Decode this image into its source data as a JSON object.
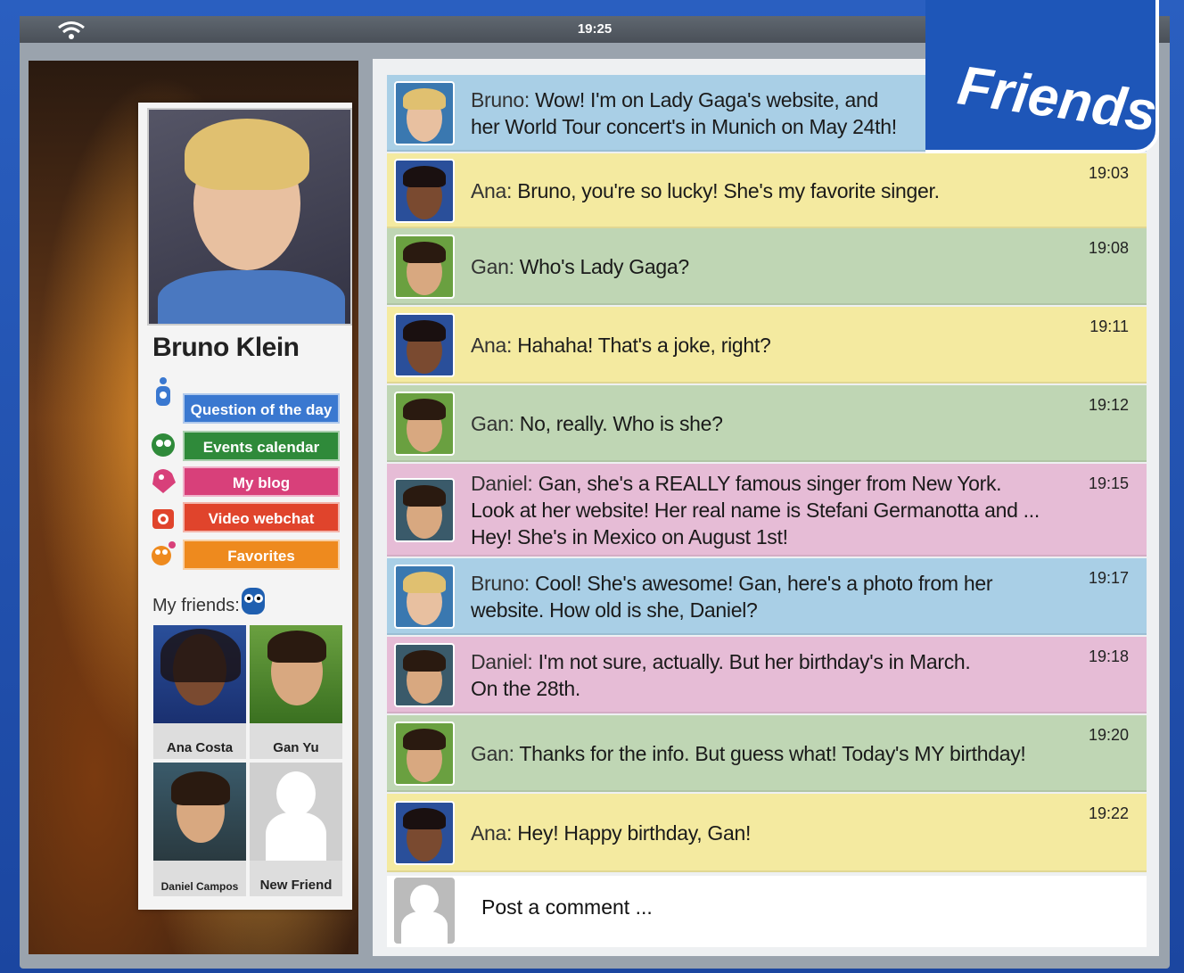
{
  "status_bar": {
    "time": "19:25"
  },
  "badge": {
    "label": "Friends"
  },
  "profile": {
    "name": "Bruno Klein",
    "menu": [
      {
        "label": "Question of the day",
        "color": "#3a78d0"
      },
      {
        "label": "Events calendar",
        "color": "#2f8a3a"
      },
      {
        "label": "My blog",
        "color": "#d8407a"
      },
      {
        "label": "Video webchat",
        "color": "#e0442c"
      },
      {
        "label": "Favorites",
        "color": "#ee8a1e"
      }
    ],
    "friends_label": "My friends:",
    "friends": [
      {
        "name": "Ana Costa"
      },
      {
        "name": "Gan Yu"
      },
      {
        "name": "Daniel Campos"
      },
      {
        "name": "New Friend"
      }
    ]
  },
  "chat": {
    "messages": [
      {
        "who": "Bruno:",
        "text": "Wow! I'm on Lady Gaga's website, and",
        "text2": "her World Tour concert's in Munich on May 24th!",
        "time": "",
        "color": "#a9cfe6"
      },
      {
        "who": "Ana:",
        "text": "Bruno, you're so lucky! She's my favorite singer.",
        "text2": "",
        "time": "19:03",
        "color": "#f4eaa0"
      },
      {
        "who": "Gan:",
        "text": "Who's Lady Gaga?",
        "text2": "",
        "time": "19:08",
        "color": "#bfd6b4"
      },
      {
        "who": "Ana:",
        "text": "Hahaha! That's a joke, right?",
        "text2": "",
        "time": "19:11",
        "color": "#f4eaa0"
      },
      {
        "who": "Gan:",
        "text": "No, really. Who is she?",
        "text2": "",
        "time": "19:12",
        "color": "#bfd6b4"
      },
      {
        "who": "Daniel:",
        "text": "Gan, she's a REALLY famous singer from New York.",
        "text2": "Look at her website! Her real name is Stefani Germanotta and ...",
        "text3": "Hey! She's in Mexico on August 1st!",
        "time": "19:15",
        "color": "#e6bcd6"
      },
      {
        "who": "Bruno:",
        "text": "Cool! She's awesome! Gan, here's a photo from her",
        "text2": "website. How old is she, Daniel?",
        "time": "19:17",
        "color": "#a9cfe6"
      },
      {
        "who": "Daniel:",
        "text": "I'm not sure, actually. But her birthday's in March.",
        "text2": "On the 28th.",
        "time": "19:18",
        "color": "#e6bcd6"
      },
      {
        "who": "Gan:",
        "text": "Thanks for the info. But guess what! Today's MY birthday!",
        "text2": "",
        "time": "19:20",
        "color": "#bfd6b4"
      },
      {
        "who": "Ana:",
        "text": "Hey! Happy birthday, Gan!",
        "text2": "",
        "time": "19:22",
        "color": "#f4eaa0"
      }
    ],
    "post_placeholder": "Post a comment ..."
  }
}
